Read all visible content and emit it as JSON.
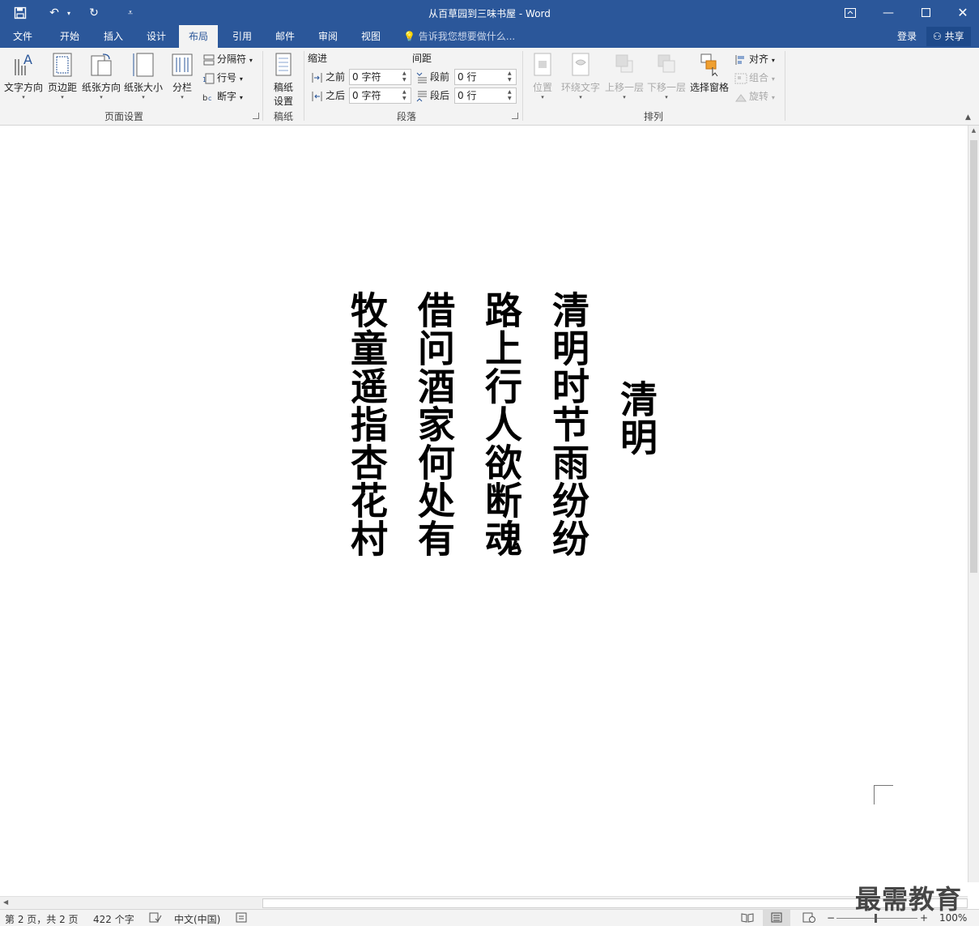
{
  "window": {
    "title": "从百草园到三味书屋 - Word",
    "customize_glyph": "⩡"
  },
  "tabs": [
    {
      "label": "文件"
    },
    {
      "label": "开始"
    },
    {
      "label": "插入"
    },
    {
      "label": "设计"
    },
    {
      "label": "布局",
      "active": true
    },
    {
      "label": "引用"
    },
    {
      "label": "邮件"
    },
    {
      "label": "审阅"
    },
    {
      "label": "视图"
    }
  ],
  "tellme": {
    "placeholder": "告诉我您想要做什么..."
  },
  "account": {
    "login": "登录",
    "share": "共享"
  },
  "ribbon": {
    "page_setup": {
      "text_direction": "文字方向",
      "margins": "页边距",
      "orientation": "纸张方向",
      "size": "纸张大小",
      "columns": "分栏",
      "breaks": "分隔符",
      "line_numbers": "行号",
      "hyphenation": "断字",
      "group_label": "页面设置"
    },
    "manuscript": {
      "settings_line1": "稿纸",
      "settings_line2": "设置",
      "group_label": "稿纸"
    },
    "paragraph": {
      "indent_label": "缩进",
      "spacing_label": "间距",
      "indent_before_label": "之前",
      "indent_after_label": "之后",
      "indent_before_value": "0 字符",
      "indent_after_value": "0 字符",
      "space_before_label": "段前",
      "space_after_label": "段后",
      "space_before_value": "0 行",
      "space_after_value": "0 行",
      "group_label": "段落"
    },
    "arrange": {
      "position": "位置",
      "wrap_text": "环绕文字",
      "bring_forward": "上移一层",
      "send_backward": "下移一层",
      "selection_pane": "选择窗格",
      "align": "对齐",
      "group": "组合",
      "rotate": "旋转",
      "group_label": "排列"
    }
  },
  "document": {
    "poem_title": "清明",
    "lines": [
      "清明时节雨纷纷",
      "路上行人欲断魂",
      "借问酒家何处有",
      "牧童遥指杏花村"
    ]
  },
  "status": {
    "page": "第 2 页，共 2 页",
    "words": "422 个字",
    "language": "中文(中国)",
    "zoom": "100%",
    "zoom_minus": "−",
    "zoom_plus": "+"
  },
  "watermark": "最需教育",
  "colors": {
    "titlebar": "#2b579a",
    "ribbon": "#f3f3f3",
    "disabled": "#a9a9a9"
  }
}
